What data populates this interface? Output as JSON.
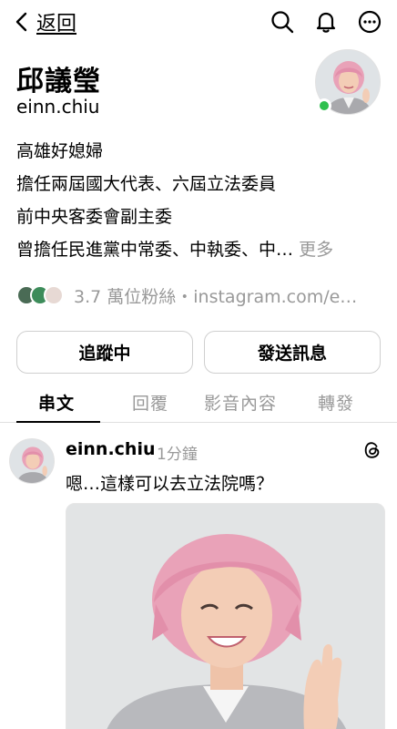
{
  "nav": {
    "back_label": "返回"
  },
  "profile": {
    "name": "邱議瑩",
    "handle": "einn.chiu",
    "bio_lines": [
      "高雄好媳婦",
      "擔任兩屆國大代表、六屆立法委員",
      "前中央客委會副主委",
      "曾擔任民進黨中常委、中執委、中…"
    ],
    "more_label": "更多",
    "followers_text": "3.7 萬位粉絲・instagram.com/e…",
    "online": true
  },
  "actions": {
    "follow_label": "追蹤中",
    "message_label": "發送訊息"
  },
  "tabs": [
    {
      "label": "串文",
      "active": true
    },
    {
      "label": "回覆",
      "active": false
    },
    {
      "label": "影音內容",
      "active": false
    },
    {
      "label": "轉發",
      "active": false
    }
  ],
  "post": {
    "author": "einn.chiu",
    "time": "1分鐘",
    "text": "嗯…這樣可以去立法院嗎？"
  },
  "colors": {
    "online": "#30c04f",
    "muted_text": "#999999",
    "border": "#cfcfcf",
    "hair_pink": "#e9a2b8"
  },
  "icons": [
    "chevron-left-icon",
    "search-icon",
    "bell-icon",
    "more-options-icon",
    "threads-logo-icon"
  ]
}
